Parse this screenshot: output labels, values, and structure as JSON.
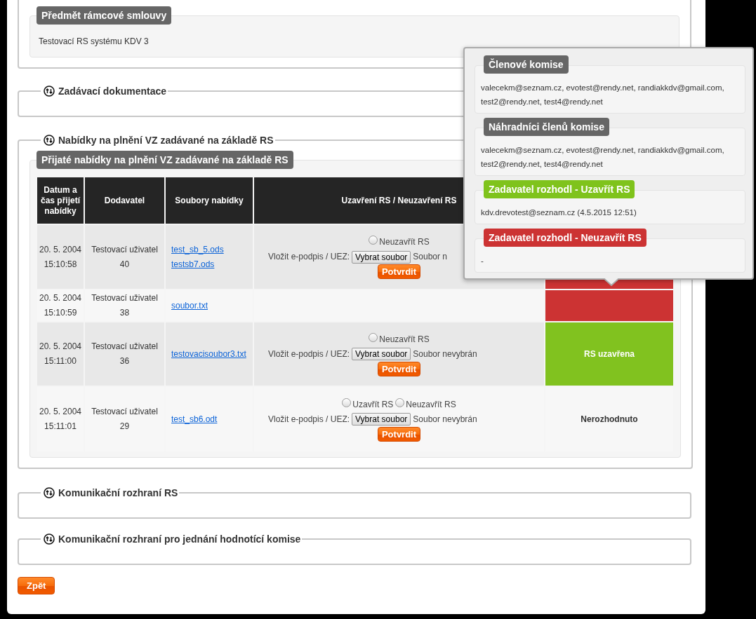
{
  "subject": {
    "title": "Předmět rámcové smlouvy",
    "text": "Testovací RS systému KDV 3"
  },
  "sections_top": [
    {
      "title": "Zadávací dokumentace"
    }
  ],
  "offers": {
    "title": "Nabídky na plnění VZ zadávané na základě RS",
    "panel_title": "Přijaté nabídky na plnění VZ zadávané na základě RS",
    "columns": [
      "Datum a čas přijetí nabídky",
      "Dodavatel",
      "Soubory nabídky",
      "Uzavření RS / Neuzavření RS"
    ],
    "rows": [
      {
        "date": "20. 5. 2004",
        "time": "15:10:58",
        "supplier": "Testovací uživatel 40",
        "files": [
          "test_sb_5.ods",
          "testsb7.ods"
        ],
        "decision": {
          "kind": "form",
          "options": [
            {
              "label": "Neuzavřít RS",
              "selected": false
            }
          ],
          "file_label": "Vložit e-podpis / UEZ:",
          "file_button": "Vybrat soubor",
          "file_status": "Soubor n",
          "confirm": "Potvrdit"
        },
        "status": {
          "kind": "hidden"
        }
      },
      {
        "date": "20. 5. 2004",
        "time": "15:10:59",
        "supplier": "Testovací uživatel 38",
        "files": [
          "soubor.txt"
        ],
        "decision": {
          "kind": "empty"
        },
        "status": {
          "kind": "rejected"
        }
      },
      {
        "date": "20. 5. 2004",
        "time": "15:11:00",
        "supplier": "Testovací uživatel 36",
        "files": [
          "testovacisoubor3.txt"
        ],
        "decision": {
          "kind": "form",
          "options": [
            {
              "label": "Neuzavřít RS",
              "selected": false
            }
          ],
          "file_label": "Vložit e-podpis / UEZ:",
          "file_button": "Vybrat soubor",
          "file_status": "Soubor nevybrán",
          "confirm": "Potvrdit"
        },
        "status": {
          "kind": "closed",
          "text": "RS uzavřena"
        }
      },
      {
        "date": "20. 5. 2004",
        "time": "15:11:01",
        "supplier": "Testovací uživatel 29",
        "files": [
          "test_sb6.odt"
        ],
        "decision": {
          "kind": "form",
          "options": [
            {
              "label": "Uzavřít RS",
              "selected": false
            },
            {
              "label": "Neuzavřít RS",
              "selected": false
            }
          ],
          "file_label": "Vložit e-podpis / UEZ:",
          "file_button": "Vybrat soubor",
          "file_status": "Soubor nevybrán",
          "confirm": "Potvrdit"
        },
        "status": {
          "kind": "undecided",
          "text": "Nerozhodnuto"
        }
      }
    ]
  },
  "sections_bottom": [
    {
      "title": "Komunikační rozhraní RS"
    },
    {
      "title": "Komunikační rozhraní pro jednání hodnotící komise"
    }
  ],
  "back_button": "Zpět",
  "popover": {
    "sections": [
      {
        "kind": "neutral",
        "title": "Členové komise",
        "text": "valecekm@seznam.cz, evotest@rendy.net, randiakkdv@gmail.com, test2@rendy.net, test4@rendy.net"
      },
      {
        "kind": "neutral",
        "title": "Náhradníci členů komise",
        "text": "valecekm@seznam.cz, evotest@rendy.net, randiakkdv@gmail.com, test2@rendy.net, test4@rendy.net"
      },
      {
        "kind": "green",
        "title": "Zadavatel rozhodl - Uzavřít RS",
        "text": "kdv.drevotest@seznam.cz (4.5.2015 12:51)"
      },
      {
        "kind": "red",
        "title": "Zadavatel rozhodl - Neuzavřít RS",
        "text": "-"
      }
    ]
  }
}
